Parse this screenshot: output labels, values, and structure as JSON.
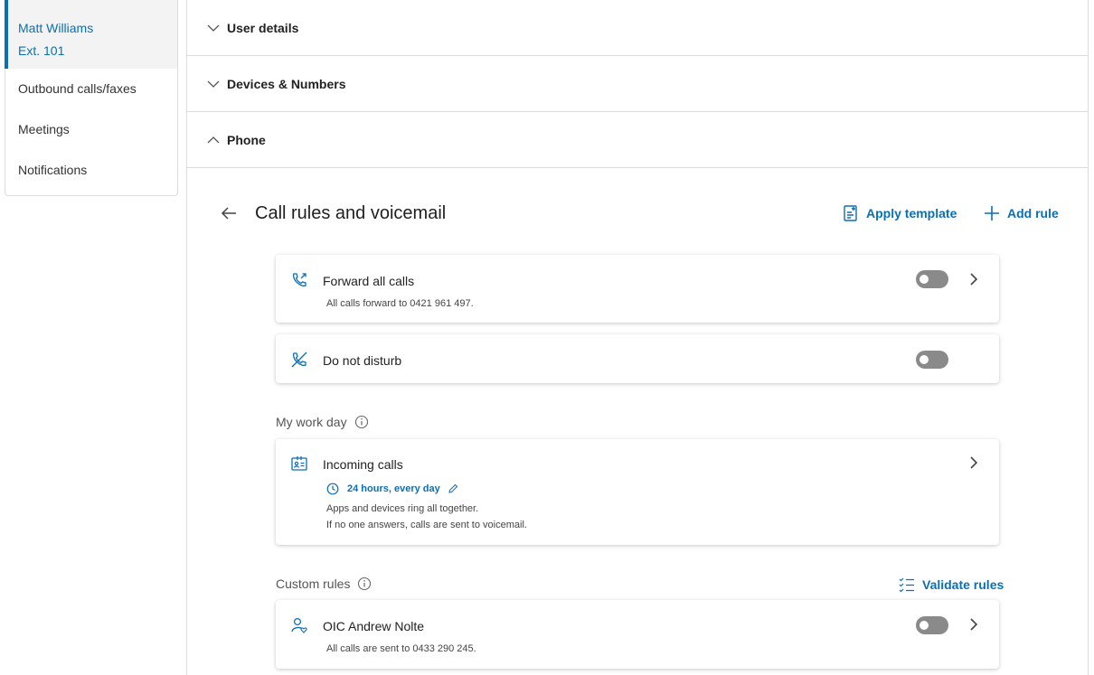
{
  "sidebar": {
    "user_name": "Matt Williams",
    "user_ext": "Ext. 101",
    "items": [
      {
        "label": "Outbound calls/faxes"
      },
      {
        "label": "Meetings"
      },
      {
        "label": "Notifications"
      }
    ]
  },
  "accordions": [
    {
      "title": "User details",
      "expanded": false
    },
    {
      "title": "Devices & Numbers",
      "expanded": false
    },
    {
      "title": "Phone",
      "expanded": true
    }
  ],
  "page": {
    "title": "Call rules and voicemail",
    "apply_template_label": "Apply template",
    "add_rule_label": "Add rule"
  },
  "rules": {
    "forward": {
      "title": "Forward all calls",
      "subtitle": "All calls forward to 0421 961 497.",
      "enabled": false
    },
    "dnd": {
      "title": "Do not disturb",
      "enabled": false
    }
  },
  "work_day": {
    "label": "My work day",
    "card": {
      "title": "Incoming calls",
      "schedule": "24 hours, every day",
      "line1": "Apps and devices ring all together.",
      "line2": "If no one answers, calls are sent to voicemail."
    }
  },
  "custom_rules": {
    "label": "Custom rules",
    "validate_label": "Validate rules",
    "items": [
      {
        "title": "OIC Andrew Nolte",
        "subtitle": "All calls are sent to 0433 290 245.",
        "enabled": false
      }
    ]
  },
  "colors": {
    "accent": "#0a6fb5",
    "toggle_off": "#8a8a8a"
  }
}
